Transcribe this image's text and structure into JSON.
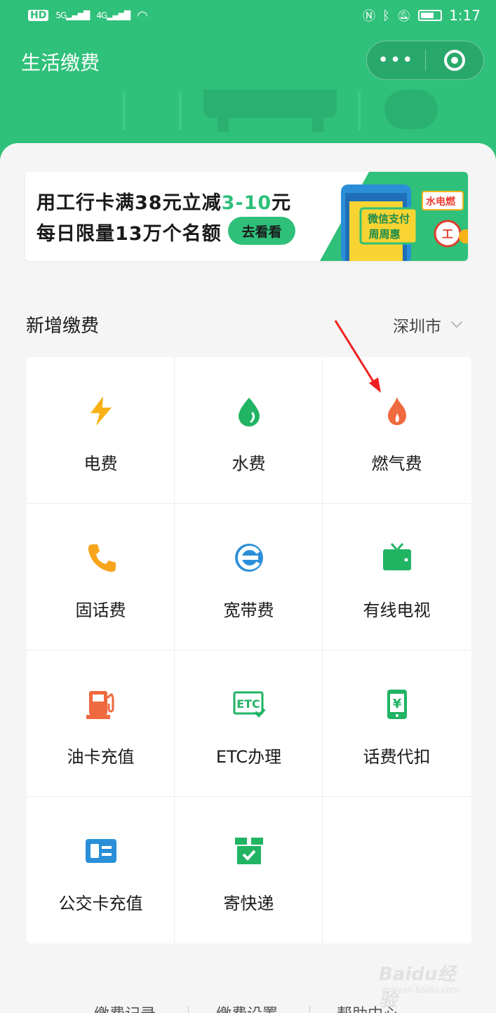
{
  "status_bar": {
    "left_text": "HD",
    "signal_1": "5G",
    "signal_2": "4G",
    "time": "1:17"
  },
  "header": {
    "title": "生活缴费",
    "more_icon": "more-dots-icon",
    "close_icon": "target-ring-icon"
  },
  "banner": {
    "line1_prefix": "用工行卡满38元立减",
    "line1_highlight": "3-10",
    "line1_suffix": "元",
    "line2": "每日限量13万个名额",
    "button": "去看看",
    "art_tag": "水电燃",
    "art_title1": "微信支付",
    "art_title2": "周周惠"
  },
  "section": {
    "title": "新增缴费",
    "city": "深圳市"
  },
  "services": [
    {
      "label": "电费",
      "icon": "lightning-icon",
      "color": "#f7b218"
    },
    {
      "label": "水费",
      "icon": "water-drop-icon",
      "color": "#20b463"
    },
    {
      "label": "燃气费",
      "icon": "flame-icon",
      "color": "#ef6a3e"
    },
    {
      "label": "固话费",
      "icon": "phone-icon",
      "color": "#f7a51c"
    },
    {
      "label": "宽带费",
      "icon": "browser-e-icon",
      "color": "#2b8fd8"
    },
    {
      "label": "有线电视",
      "icon": "tv-icon",
      "color": "#20b463"
    },
    {
      "label": "油卡充值",
      "icon": "fuel-pump-icon",
      "color": "#ef6a3e"
    },
    {
      "label": "ETC办理",
      "icon": "etc-icon",
      "color": "#20b463"
    },
    {
      "label": "话费代扣",
      "icon": "mobile-yuan-icon",
      "color": "#20b463"
    },
    {
      "label": "公交卡充值",
      "icon": "bus-card-icon",
      "color": "#2b8fd8"
    },
    {
      "label": "寄快递",
      "icon": "parcel-box-icon",
      "color": "#20b463"
    }
  ],
  "footer": {
    "links": [
      "缴费记录",
      "缴费设置",
      "帮助中心"
    ]
  },
  "watermark": {
    "text": "Baidu经验",
    "sub": "jingyan.baidu.com"
  }
}
